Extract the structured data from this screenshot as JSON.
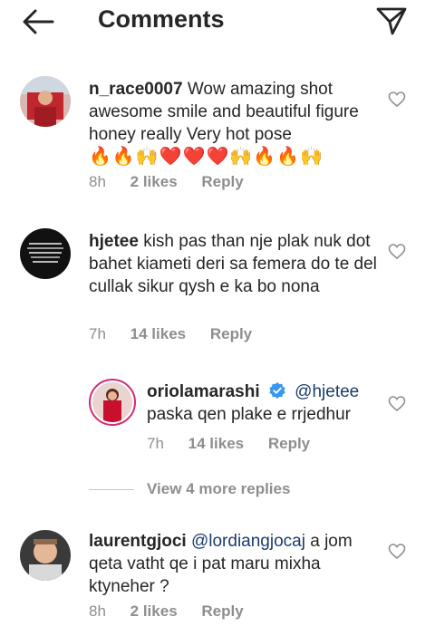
{
  "header": {
    "title": "Comments"
  },
  "comments": [
    {
      "username": "n_race0007",
      "text": "Wow amazing shot awesome smile and beautiful figure honey really Very hot pose",
      "emojis": "🔥🔥🙌❤️❤️❤️🙌🔥🔥🙌",
      "time": "8h",
      "likes": "2 likes",
      "reply": "Reply"
    },
    {
      "username": "hjetee",
      "text": "kish pas than nje plak nuk dot bahet kiameti deri sa femera do te del cullak sikur qysh e ka bo nona",
      "time": "7h",
      "likes": "14 likes",
      "reply": "Reply"
    },
    {
      "username": "oriolamarashi",
      "mention": "@hjetee",
      "text": "paska qen plake e rrjedhur",
      "time": "7h",
      "likes": "14 likes",
      "reply": "Reply"
    },
    {
      "username": "laurentgjoci",
      "mention": "@lordiangjocaj",
      "text": "a jom qeta vatht qe i pat maru mixha ktyneher ?",
      "time": "8h",
      "likes": "2 likes",
      "reply": "Reply"
    }
  ],
  "view_more": "View 4 more replies"
}
